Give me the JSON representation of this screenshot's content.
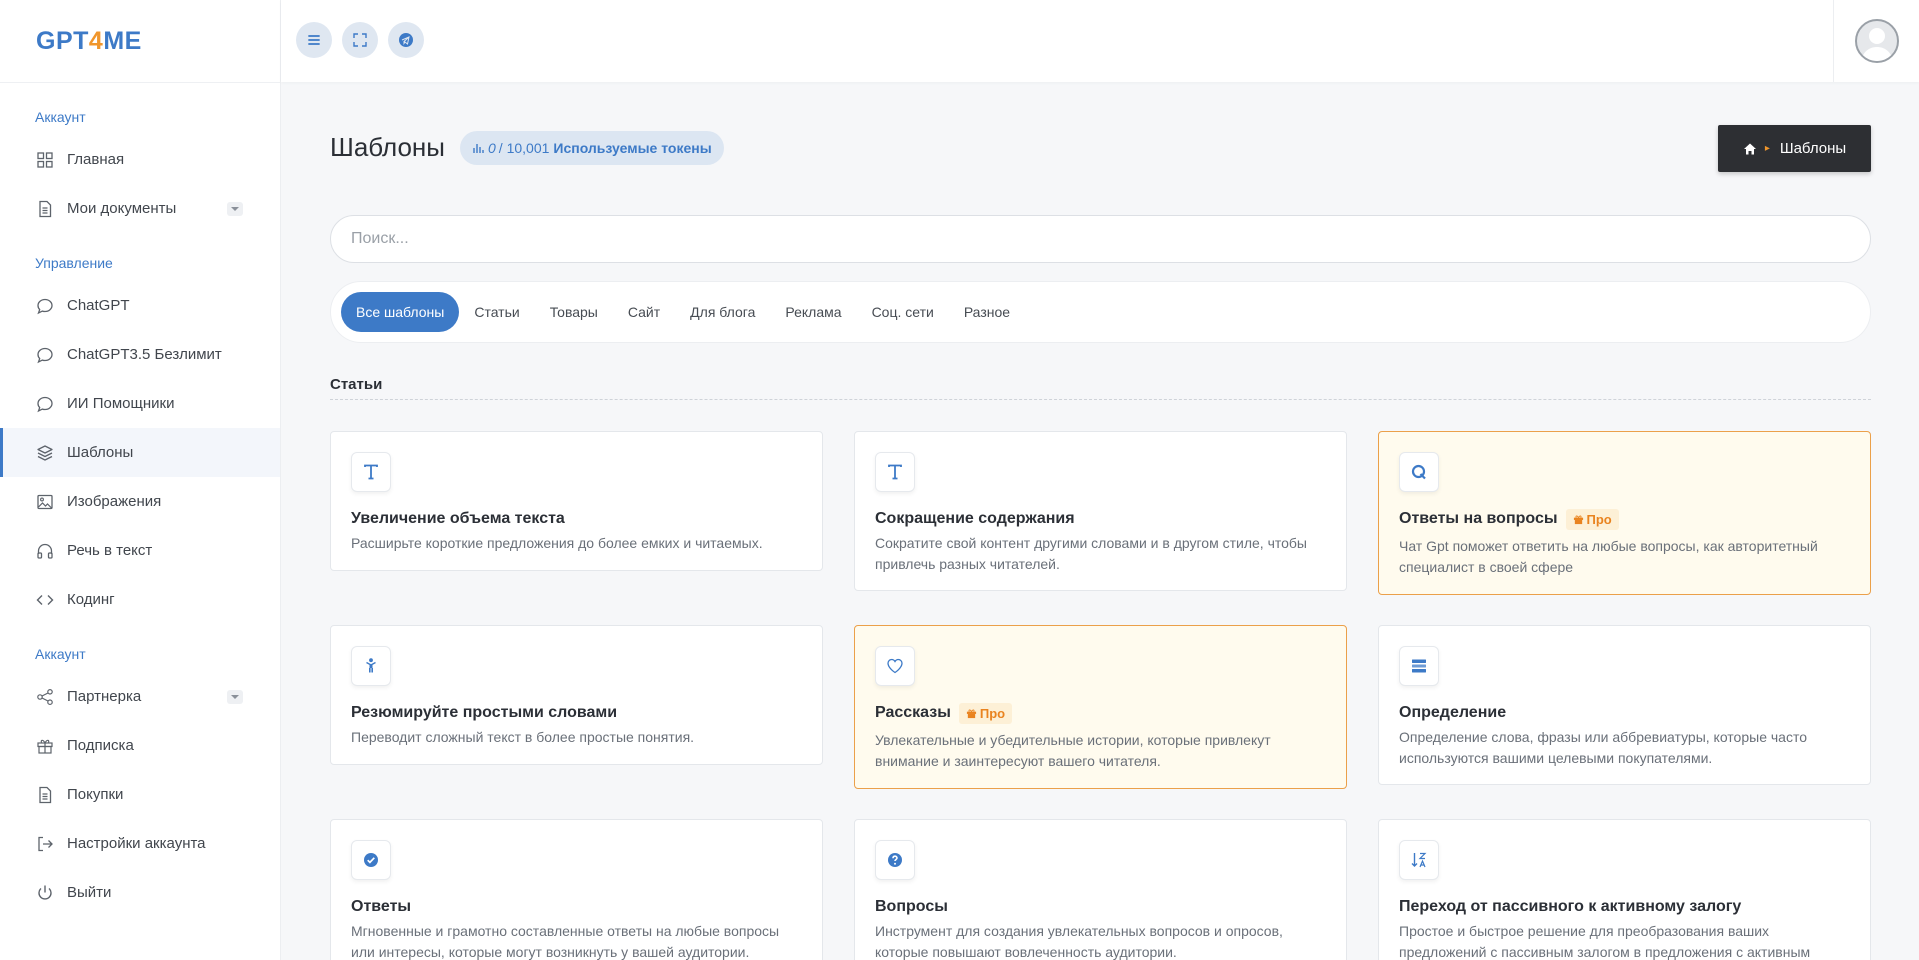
{
  "logo": {
    "part1": "GPT",
    "part2": "4",
    "part3": "ME"
  },
  "sidebar": {
    "groups": [
      {
        "title": "Аккаунт",
        "items": [
          {
            "label": "Главная",
            "icon": "grid-icon"
          },
          {
            "label": "Мои документы",
            "icon": "document-icon",
            "has_dropdown": true
          }
        ]
      },
      {
        "title": "Управление",
        "items": [
          {
            "label": "ChatGPT",
            "icon": "chat-icon"
          },
          {
            "label": "ChatGPT3.5 Безлимит",
            "icon": "chat-icon"
          },
          {
            "label": "ИИ Помощники",
            "icon": "chat-icon"
          },
          {
            "label": "Шаблоны",
            "icon": "layers-icon",
            "active": true
          },
          {
            "label": "Изображения",
            "icon": "image-icon"
          },
          {
            "label": "Речь в текст",
            "icon": "headphones-icon"
          },
          {
            "label": "Кодинг",
            "icon": "code-icon"
          }
        ]
      },
      {
        "title": "Аккаунт",
        "items": [
          {
            "label": "Партнерка",
            "icon": "share-icon",
            "has_dropdown": true
          },
          {
            "label": "Подписка",
            "icon": "gift-icon"
          },
          {
            "label": "Покупки",
            "icon": "document-icon"
          },
          {
            "label": "Настройки аккаунта",
            "icon": "sign-in-icon"
          },
          {
            "label": "Выйти",
            "icon": "power-icon"
          }
        ]
      }
    ]
  },
  "header": {
    "buttons": [
      "menu-icon",
      "fullscreen-icon",
      "telegram-icon"
    ]
  },
  "page": {
    "title": "Шаблоны",
    "tokens": {
      "used": "0",
      "total": "/ 10,001",
      "label": "Используемые токены"
    },
    "breadcrumb": "Шаблоны"
  },
  "search": {
    "placeholder": "Поиск..."
  },
  "tabs": [
    "Все шаблоны",
    "Статьи",
    "Товары",
    "Сайт",
    "Для блога",
    "Реклама",
    "Соц. сети",
    "Разное"
  ],
  "active_tab": "Все шаблоны",
  "section_title": "Статьи",
  "pro_label": "Про",
  "cards": [
    {
      "title": "Увеличение объема текста",
      "desc": "Расширьте короткие предложения до более емких и читаемых.",
      "icon": "text-icon",
      "pro": false
    },
    {
      "title": "Сокращение содержания",
      "desc": "Сократите свой контент другими словами и в другом стиле, чтобы привлечь разных читателей.",
      "icon": "text-icon",
      "pro": false
    },
    {
      "title": "Ответы на вопросы",
      "desc": "Чат Gpt поможет ответить на любые вопросы, как авторитетный специалист в своей сфере",
      "icon": "q-letter-icon",
      "pro": true
    },
    {
      "title": "Резюмируйте простыми словами",
      "desc": "Переводит сложный текст в более простые понятия.",
      "icon": "child-icon",
      "pro": false
    },
    {
      "title": "Рассказы",
      "desc": "Увлекательные и убедительные истории, которые привлекут внимание и заинтересуют вашего читателя.",
      "icon": "heart-icon",
      "pro": true
    },
    {
      "title": "Определение",
      "desc": "Определение слова, фразы или аббревиатуры, которые часто используются вашими целевыми покупателями.",
      "icon": "list-box-icon",
      "pro": false
    },
    {
      "title": "Ответы",
      "desc": "Мгновенные и грамотно составленные ответы на любые вопросы или интересы, которые могут возникнуть у вашей аудитории.",
      "icon": "check-circle-icon",
      "pro": false
    },
    {
      "title": "Вопросы",
      "desc": "Инструмент для создания увлекательных вопросов и опросов, которые повышают вовлеченность аудитории.",
      "icon": "question-circle-icon",
      "pro": false
    },
    {
      "title": "Переход от пассивного к активному залогу",
      "desc": "Простое и быстрое решение для преобразования ваших предложений с пассивным залогом в предложения с активным",
      "icon": "sort-az-icon",
      "pro": false
    }
  ],
  "colors": {
    "accent": "#3d7ac7",
    "orange": "#f0962c",
    "pro_border": "#eba04a"
  }
}
